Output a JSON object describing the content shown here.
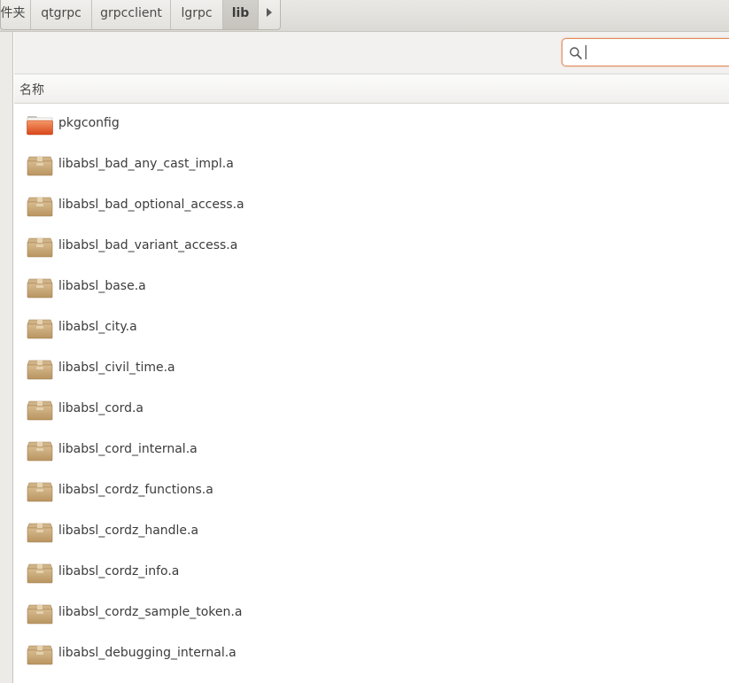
{
  "pathbar": {
    "crumbs": [
      {
        "label": "文件夹",
        "active": false
      },
      {
        "label": "qtgrpc",
        "active": false
      },
      {
        "label": "grpcclient",
        "active": false
      },
      {
        "label": "lgrpc",
        "active": false
      },
      {
        "label": "lib",
        "active": true
      }
    ]
  },
  "search": {
    "value": "",
    "placeholder": ""
  },
  "columns": {
    "name": "名称"
  },
  "files": [
    {
      "name": "pkgconfig",
      "type": "folder"
    },
    {
      "name": "libabsl_bad_any_cast_impl.a",
      "type": "archive"
    },
    {
      "name": "libabsl_bad_optional_access.a",
      "type": "archive"
    },
    {
      "name": "libabsl_bad_variant_access.a",
      "type": "archive"
    },
    {
      "name": "libabsl_base.a",
      "type": "archive"
    },
    {
      "name": "libabsl_city.a",
      "type": "archive"
    },
    {
      "name": "libabsl_civil_time.a",
      "type": "archive"
    },
    {
      "name": "libabsl_cord.a",
      "type": "archive"
    },
    {
      "name": "libabsl_cord_internal.a",
      "type": "archive"
    },
    {
      "name": "libabsl_cordz_functions.a",
      "type": "archive"
    },
    {
      "name": "libabsl_cordz_handle.a",
      "type": "archive"
    },
    {
      "name": "libabsl_cordz_info.a",
      "type": "archive"
    },
    {
      "name": "libabsl_cordz_sample_token.a",
      "type": "archive"
    },
    {
      "name": "libabsl_debugging_internal.a",
      "type": "archive"
    }
  ],
  "colors": {
    "accent": "#e95420",
    "folder": "#e0572a",
    "archive": "#c8a675"
  },
  "icons": {
    "search": "search-icon",
    "folder": "folder-icon",
    "archive": "package-icon",
    "next": "chevron-right-icon"
  }
}
